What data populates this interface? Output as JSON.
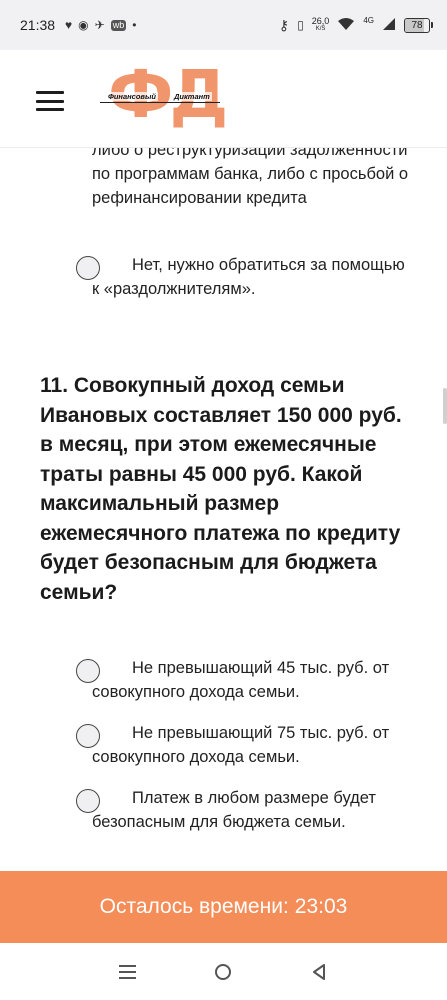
{
  "status_bar": {
    "time": "21:38",
    "left_icons": [
      "heart-icon",
      "messenger-icon",
      "vk-icon",
      "wb-icon",
      "dot-icon"
    ],
    "net_speed": "26,0",
    "net_speed_unit": "K/S",
    "network": "4G",
    "battery_level": "78",
    "battery_fraction": 0.78
  },
  "header": {
    "logo_letters": "ФД",
    "logo_word1": "Финансовый",
    "logo_word2": "Диктант"
  },
  "previous_question": {
    "options": [
      {
        "text": "либо о реструктуризации задолженности по программам банка, либо с просьбой о рефинансировании кредита"
      },
      {
        "text": "Нет, нужно обратиться за помощью к «раздолжнителям»."
      }
    ]
  },
  "question": {
    "text": "11. Совокупный доход семьи Ивановых составляет 150 000 руб. в месяц, при этом ежемесячные траты равны 45 000 руб. Какой максимальный размер ежемесячного платежа по кредиту будет безопасным для бюджета семьи?",
    "options": [
      {
        "text": "Не превышающий 45 тыс. руб. от совокупного дохода семьи."
      },
      {
        "text": "Не превышающий 75 тыс. руб. от совокупного дохода семьи."
      },
      {
        "text": "Платеж в любом размере будет безопасным для бюджета семьи."
      }
    ]
  },
  "timer": {
    "label": "Осталось времени:",
    "value": "23:03"
  },
  "nav": {
    "buttons": [
      "recent-apps-icon",
      "home-icon",
      "back-icon"
    ]
  },
  "colors": {
    "accent": "#f58d58",
    "logo": "#f08a5d",
    "status_bar_bg": "#f1f1f3"
  }
}
